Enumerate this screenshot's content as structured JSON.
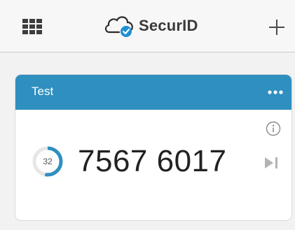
{
  "header": {
    "brand_name": "SecurID",
    "menu_icon": "grid-icon",
    "add_icon": "plus-icon",
    "logo_icon": "cloud-check-icon"
  },
  "token": {
    "name": "Test",
    "code": "7567 6017",
    "seconds_remaining": "32",
    "timer_fraction": 0.53,
    "menu_icon": "more-horizontal-icon",
    "info_icon": "info-icon",
    "next_icon": "skip-next-icon"
  },
  "colors": {
    "accent": "#2f8fbf",
    "header_bg": "#f7f7f7",
    "page_bg": "#f2f2f2"
  }
}
